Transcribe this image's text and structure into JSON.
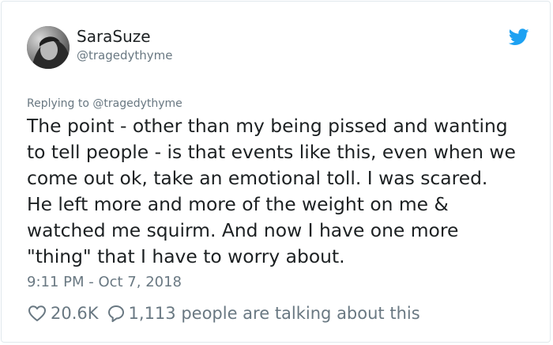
{
  "author": {
    "display_name": "SaraSuze",
    "handle": "@tragedythyme"
  },
  "reply": {
    "text": "Replying to @tragedythyme"
  },
  "tweet": {
    "lines": [
      "The point - other than my being pissed and wanting",
      "to tell people - is that events like this, even when we",
      "come out ok, take an emotional toll. I was scared.",
      "He left more and more of the weight on me &",
      "watched me squirm. And now I have one more",
      "\"thing\" that I have to worry about."
    ],
    "timestamp": "9:11 PM - Oct 7, 2018"
  },
  "actions": {
    "likes": "20.6K",
    "conversation": "1,113 people are talking about this"
  },
  "icons": {
    "avatar": "profile-photo",
    "brand": "twitter-bird-icon",
    "like": "heart-icon",
    "reply": "speech-bubble-icon"
  },
  "colors": {
    "brand": "#1da1f2",
    "text": "#1c2022",
    "muted": "#697882",
    "border": "#e1e8ed"
  }
}
